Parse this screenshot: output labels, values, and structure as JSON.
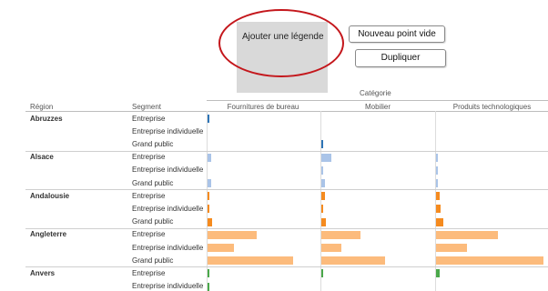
{
  "legend_box": {
    "label": "Ajouter une légende"
  },
  "buttons": {
    "new_point": "Nouveau point vide",
    "duplicate": "Dupliquer"
  },
  "table": {
    "category_label": "Catégorie",
    "region_header": "Région",
    "segment_header": "Segment",
    "columns": [
      "Fournitures de bureau",
      "Mobilier",
      "Produits technologiques"
    ],
    "regions": [
      {
        "name": "Abruzzes",
        "color": "#2e75b6",
        "rows": [
          {
            "segment": "Entreprise",
            "values": [
              0.015,
              0,
              0
            ]
          },
          {
            "segment": "Entreprise individuelle",
            "values": [
              0,
              0,
              0
            ]
          },
          {
            "segment": "Grand public",
            "values": [
              0,
              0.02,
              0
            ]
          }
        ]
      },
      {
        "name": "Alsace",
        "color": "#aac4e8",
        "rows": [
          {
            "segment": "Entreprise",
            "values": [
              0.03,
              0.09,
              0.015
            ]
          },
          {
            "segment": "Entreprise individuelle",
            "values": [
              0,
              0.01,
              0.008
            ]
          },
          {
            "segment": "Grand public",
            "values": [
              0.03,
              0.03,
              0.008
            ]
          }
        ]
      },
      {
        "name": "Andalousie",
        "color": "#f58b1f",
        "rows": [
          {
            "segment": "Entreprise",
            "values": [
              0.015,
              0.03,
              0.03
            ]
          },
          {
            "segment": "Entreprise individuelle",
            "values": [
              0.01,
              0.01,
              0.04
            ]
          },
          {
            "segment": "Grand public",
            "values": [
              0.04,
              0.04,
              0.07
            ]
          }
        ]
      },
      {
        "name": "Angleterre",
        "color": "#fcbb7c",
        "rows": [
          {
            "segment": "Entreprise",
            "values": [
              0.45,
              0.36,
              0.57
            ]
          },
          {
            "segment": "Entreprise individuelle",
            "values": [
              0.24,
              0.18,
              0.28
            ]
          },
          {
            "segment": "Grand public",
            "values": [
              0.78,
              0.58,
              0.98
            ]
          }
        ]
      },
      {
        "name": "Anvers",
        "color": "#4aa84a",
        "rows": [
          {
            "segment": "Entreprise",
            "values": [
              0.01,
              0.01,
              0.03
            ]
          },
          {
            "segment": "Entreprise individuelle",
            "values": [
              0.008,
              0,
              0
            ]
          }
        ]
      }
    ]
  }
}
